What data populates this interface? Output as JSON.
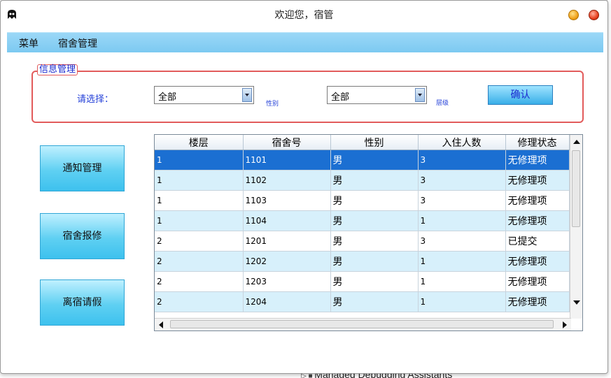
{
  "window": {
    "title": "欢迎您，宿管"
  },
  "menu": {
    "items": [
      "菜单",
      "宿舍管理"
    ]
  },
  "filter": {
    "legend": "信息管理",
    "select_label": "请选择：",
    "gender_value": "全部",
    "gender_label": "性别",
    "floor_value": "全部",
    "floor_label": "层级",
    "confirm_label": "确认"
  },
  "side_buttons": [
    "通知管理",
    "宿舍报修",
    "离宿请假"
  ],
  "table": {
    "columns": [
      "楼层",
      "宿舍号",
      "性别",
      "入住人数",
      "修理状态"
    ],
    "rows": [
      [
        "1",
        "1101",
        "男",
        "3",
        "无修理项"
      ],
      [
        "1",
        "1102",
        "男",
        "3",
        "无修理项"
      ],
      [
        "1",
        "1103",
        "男",
        "3",
        "无修理项"
      ],
      [
        "1",
        "1104",
        "男",
        "1",
        "无修理项"
      ],
      [
        "2",
        "1201",
        "男",
        "3",
        "已提交"
      ],
      [
        "2",
        "1202",
        "男",
        "1",
        "无修理项"
      ],
      [
        "2",
        "1203",
        "男",
        "1",
        "无修理项"
      ],
      [
        "2",
        "1204",
        "男",
        "1",
        "无修理项"
      ]
    ],
    "selected_row": 0
  },
  "background_app": {
    "visible_text": "Managed Debugging Assistants"
  },
  "colors": {
    "menubar": "#7cc9f1",
    "selection": "#1b6fd2",
    "group_border": "#e25b5b",
    "label_blue": "#2440d8"
  }
}
